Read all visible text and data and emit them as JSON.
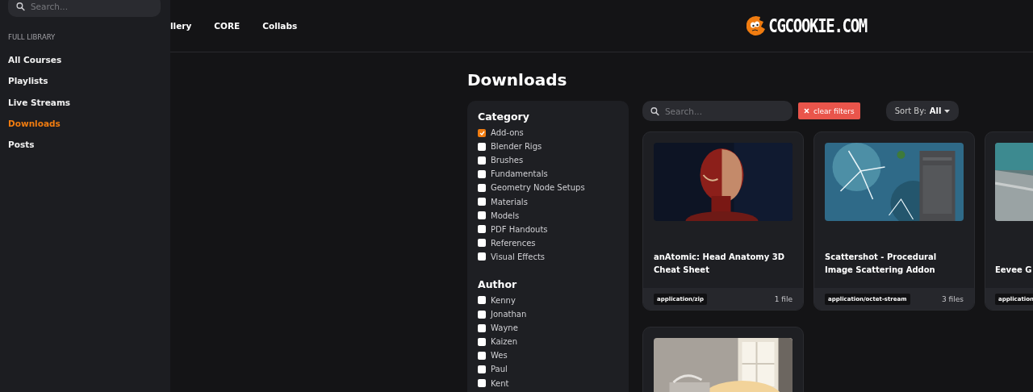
{
  "sidebar": {
    "search": {
      "placeholder": "Search..."
    },
    "section_label": "FULL LIBRARY",
    "items": [
      {
        "label": "All Courses",
        "selected": false
      },
      {
        "label": "Playlists",
        "selected": false
      },
      {
        "label": "Live Streams",
        "selected": false
      },
      {
        "label": "Downloads",
        "selected": true
      },
      {
        "label": "Posts",
        "selected": false
      }
    ]
  },
  "header": {
    "nav_links": [
      "llery",
      "CORE",
      "Collabs"
    ],
    "logo": "CGCOOKIE.COM"
  },
  "page_title": "Downloads",
  "filters": [
    {
      "title": "Category",
      "options": [
        {
          "label": "Add-ons",
          "checked": true
        },
        {
          "label": "Blender Rigs",
          "checked": false
        },
        {
          "label": "Brushes",
          "checked": false
        },
        {
          "label": "Fundamentals",
          "checked": false
        },
        {
          "label": "Geometry Node Setups",
          "checked": false
        },
        {
          "label": "Materials",
          "checked": false
        },
        {
          "label": "Models",
          "checked": false
        },
        {
          "label": "PDF Handouts",
          "checked": false
        },
        {
          "label": "References",
          "checked": false
        },
        {
          "label": "Visual Effects",
          "checked": false
        }
      ]
    },
    {
      "title": "Author",
      "options": [
        {
          "label": "Kenny",
          "checked": false
        },
        {
          "label": "Jonathan",
          "checked": false
        },
        {
          "label": "Wayne",
          "checked": false
        },
        {
          "label": "Kaizen",
          "checked": false
        },
        {
          "label": "Wes",
          "checked": false
        },
        {
          "label": "Paul",
          "checked": false
        },
        {
          "label": "Kent",
          "checked": false
        }
      ]
    }
  ],
  "toolbar": {
    "search": {
      "placeholder": "Search..."
    },
    "clear_filters": "clear filters",
    "sort_label": "Sort By:",
    "sort_value": "All"
  },
  "cards": [
    {
      "image": {
        "kind": "picture"
      },
      "title": "anAtomic: Head Anatomy 3D Cheat Sheet",
      "file_type": "application/zip",
      "file_count": "1 file"
    },
    {
      "image": {
        "kind": "picture"
      },
      "title": "Scattershot - Procedural Image Scattering Addon",
      "file_type": "application/octet-stream",
      "file_count": "3 files"
    },
    {
      "image": {
        "kind": "picture"
      },
      "title": "Eevee G",
      "file_type": "application"
    },
    {
      "image": {
        "kind": "picture"
      }
    }
  ]
}
